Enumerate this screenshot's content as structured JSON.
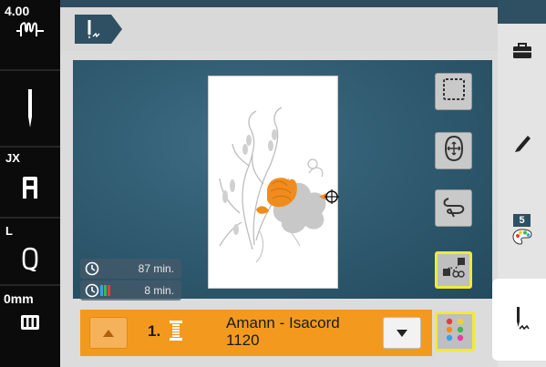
{
  "left_rail": {
    "stitch_width": "4.00",
    "presser_foot_label": "JX",
    "bobbin_label": "L",
    "feed_label": "0mm"
  },
  "embroidery": {
    "time_total": "87 min.",
    "time_color": "8 min."
  },
  "color_bar": {
    "index": "1.",
    "thread_name": "Amann - Isacord",
    "thread_code": "1120"
  },
  "right_rail": {
    "badge_count": "5"
  },
  "icons": [
    "stitch-pattern-icon",
    "needle-icon",
    "presser-foot-icon",
    "bobbin-icon",
    "feed-dog-icon",
    "hoop-icon",
    "move-icon",
    "stitch-path-icon",
    "crosshair-icon",
    "color-sort-icon",
    "clock-icon",
    "toolbox-icon",
    "pencil-icon",
    "palette-icon",
    "embroidery-icon"
  ],
  "colors": {
    "accent": "#f39a1e",
    "highlight": "#f0ea3a",
    "work_area": "#2f5a70",
    "design_orange": "#f08c1e",
    "design_gray": "#c8c8c8"
  }
}
